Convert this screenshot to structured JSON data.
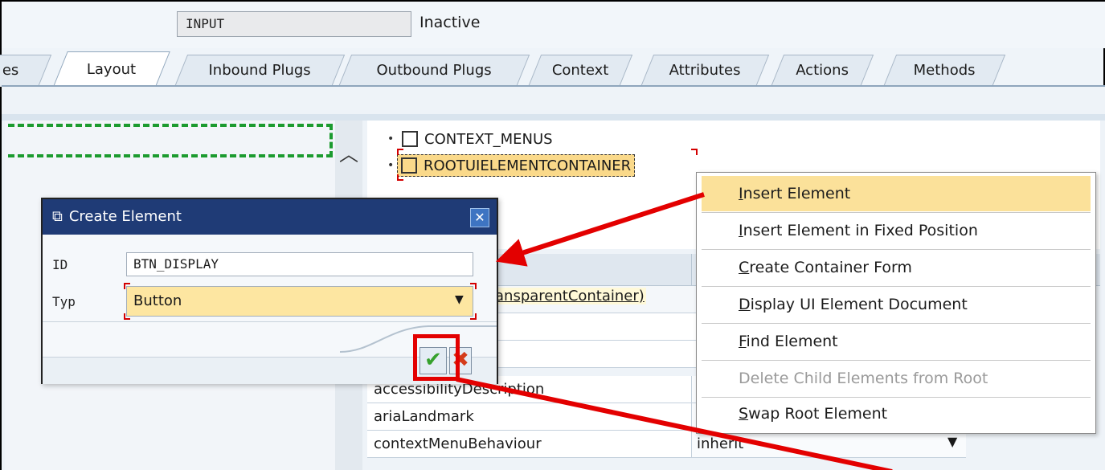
{
  "header": {
    "view_name": "INPUT",
    "status": "Inactive"
  },
  "tabs": [
    {
      "label": "es"
    },
    {
      "label": "Layout"
    },
    {
      "label": "Inbound Plugs"
    },
    {
      "label": "Outbound Plugs"
    },
    {
      "label": "Context"
    },
    {
      "label": "Attributes"
    },
    {
      "label": "Actions"
    },
    {
      "label": "Methods"
    }
  ],
  "tree": {
    "items": [
      {
        "label": "CONTEXT_MENUS"
      },
      {
        "label": "ROOTUIELEMENTCONTAINER"
      }
    ]
  },
  "properties": {
    "element_type_fragment": "ansparentContainer)",
    "rows": [
      {
        "name": "accessibilityDescription",
        "value": ""
      },
      {
        "name": "ariaLandmark",
        "value": ""
      },
      {
        "name": "contextMenuBehaviour",
        "value": "inherit"
      }
    ]
  },
  "dialog": {
    "title": "Create Element",
    "id_label": "ID",
    "id_value": "BTN_DISPLAY",
    "type_label": "Typ",
    "type_value": "Button"
  },
  "context_menu": {
    "items": [
      {
        "mnemonic": "I",
        "rest": "nsert Element",
        "enabled": true
      },
      {
        "mnemonic": "I",
        "rest": "nsert Element in Fixed Position",
        "enabled": true
      },
      {
        "mnemonic": "C",
        "rest": "reate Container Form",
        "enabled": true
      },
      {
        "mnemonic": "D",
        "rest": "isplay UI Element Document",
        "enabled": true
      },
      {
        "mnemonic": "F",
        "rest": "ind Element",
        "enabled": true
      },
      {
        "mnemonic": "",
        "rest": "Delete Child Elements from Root",
        "enabled": false
      },
      {
        "mnemonic": "S",
        "rest": "wap Root Element",
        "enabled": true
      }
    ]
  },
  "colors": {
    "title_bar": "#1f3b76",
    "highlight": "#fbe19a",
    "annotation_red": "#e30000",
    "dashed_green": "#1c9b2f"
  }
}
